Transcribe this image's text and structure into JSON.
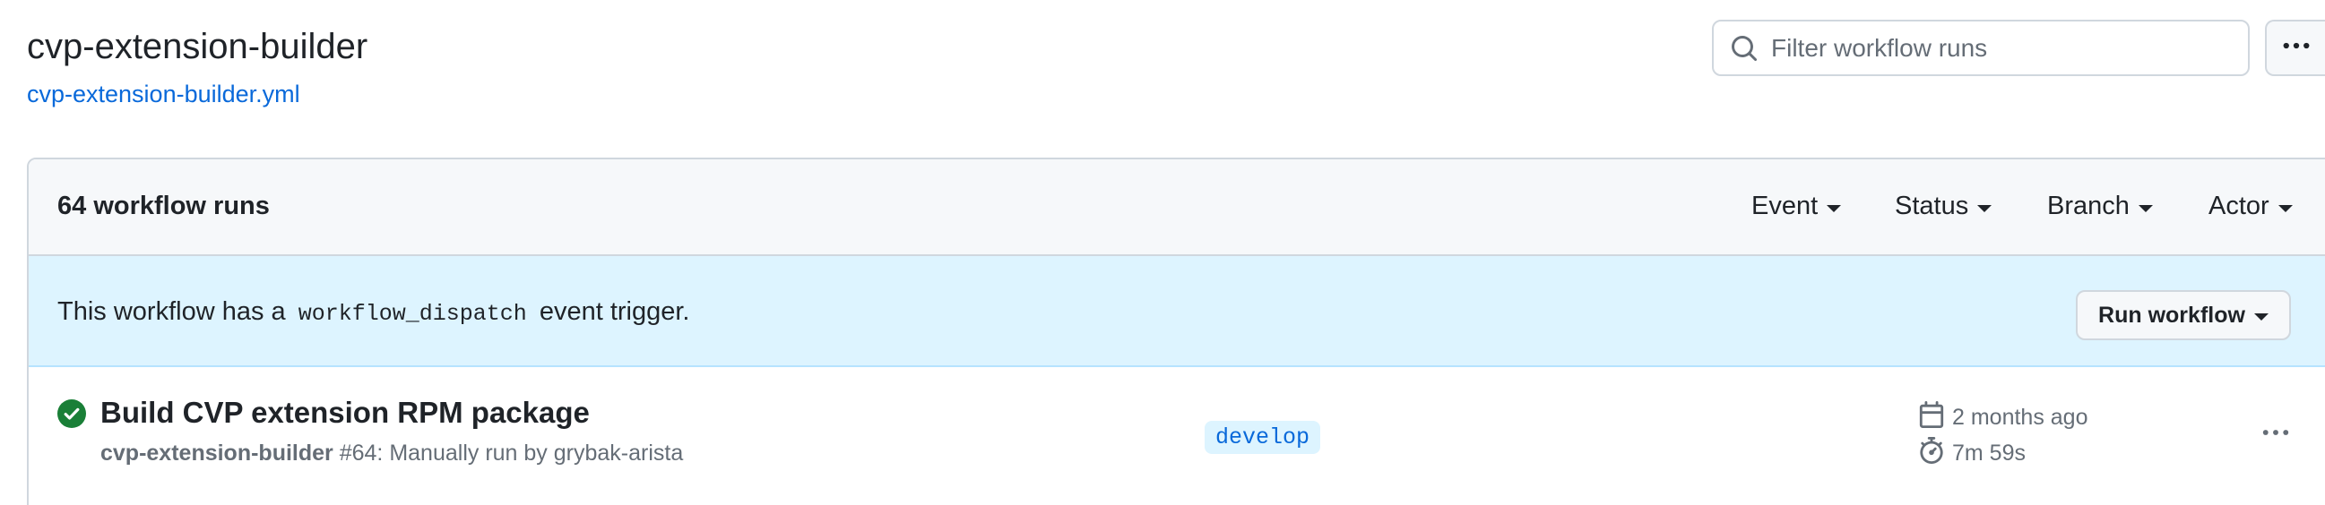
{
  "workflow": {
    "title": "cvp-extension-builder",
    "file": "cvp-extension-builder.yml"
  },
  "search": {
    "placeholder": "Filter workflow runs",
    "value": ""
  },
  "icons": {
    "search": "search-icon",
    "kebab": "kebab-horizontal-icon",
    "success": "check-circle-fill-icon",
    "calendar": "calendar-icon",
    "stopwatch": "stopwatch-icon",
    "caret": "triangle-down-icon"
  },
  "runs_header": {
    "count_label": "64 workflow runs",
    "filters": [
      "Event",
      "Status",
      "Branch",
      "Actor"
    ]
  },
  "banner": {
    "text_before": "This workflow has a",
    "code": "workflow_dispatch",
    "text_after": "event trigger.",
    "button_label": "Run workflow"
  },
  "runs": [
    {
      "title": "Build CVP extension RPM package",
      "workflow_name": "cvp-extension-builder",
      "run_info": "#64: Manually run by grybak-arista",
      "branch": "develop",
      "time_ago": "2 months ago",
      "duration": "7m 59s",
      "status": "success"
    }
  ],
  "colors": {
    "accent": "#0969da",
    "success": "#1a7f37",
    "banner_bg": "#ddf4ff",
    "header_bg": "#f6f8fa",
    "border": "#d0d7de",
    "text": "#1f2328",
    "muted": "#656d76"
  }
}
